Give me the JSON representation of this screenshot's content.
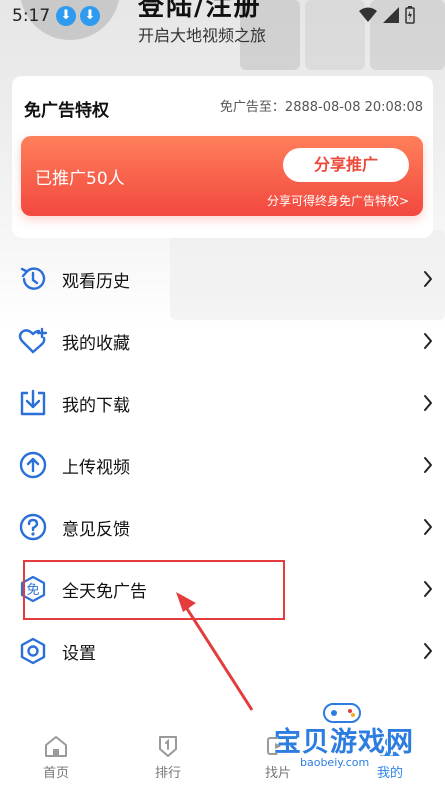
{
  "status_bar": {
    "time": "5:17"
  },
  "profile": {
    "login_title": "登陆/注册",
    "subtitle": "开启大地视频之旅"
  },
  "privilege": {
    "title": "免广告特权",
    "expire": "免广告至：2888-08-08 20:08:08",
    "promoted_count": "已推广50人",
    "share_label": "分享推广",
    "hint": "分享可得终身免广告特权>"
  },
  "menu": [
    {
      "label": "观看历史",
      "icon": "history-icon"
    },
    {
      "label": "我的收藏",
      "icon": "heart-plus-icon"
    },
    {
      "label": "我的下载",
      "icon": "download-icon"
    },
    {
      "label": "上传视频",
      "icon": "upload-icon"
    },
    {
      "label": "意见反馈",
      "icon": "question-icon"
    },
    {
      "label": "全天免广告",
      "icon": "ad-free-icon"
    },
    {
      "label": "设置",
      "icon": "settings-icon"
    }
  ],
  "bottom_nav": [
    {
      "label": "首页",
      "icon": "home-icon"
    },
    {
      "label": "排行",
      "icon": "ranking-icon"
    },
    {
      "label": "找片",
      "icon": "find-icon"
    },
    {
      "label": "我的",
      "icon": "profile-icon"
    }
  ],
  "watermark": {
    "text": "宝贝游戏网",
    "url": "baobeiy.com"
  },
  "colors": {
    "accent": "#2f86e8",
    "promo_top": "#ff7f5a",
    "promo_bottom": "#f2483f",
    "annotation": "#e43c3c"
  }
}
